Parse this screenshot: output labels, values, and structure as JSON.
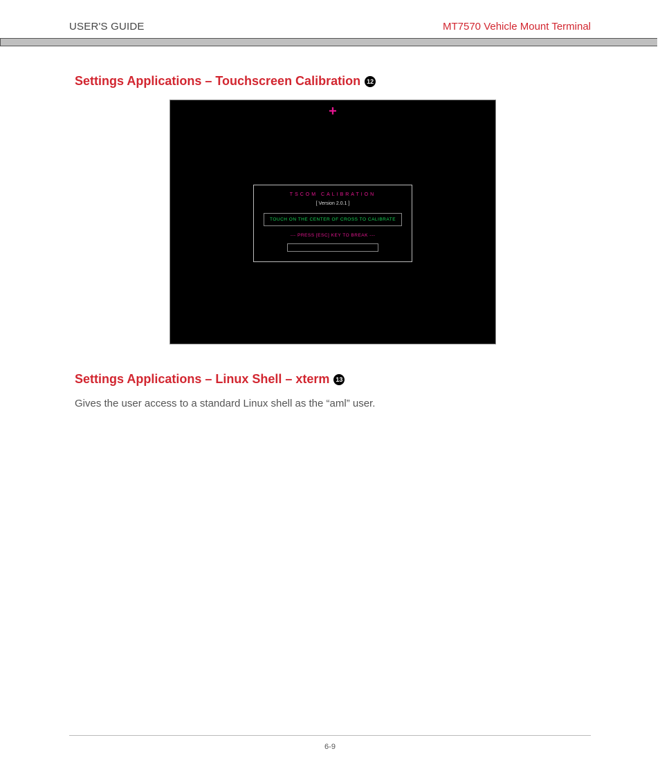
{
  "header": {
    "left": "USER'S GUIDE",
    "right": "MT7570 Vehicle Mount Terminal"
  },
  "section1": {
    "title": "Settings Applications – Touchscreen Calibration",
    "badge": "12",
    "screenshot": {
      "title": "TSCOM CALIBRATION",
      "version": "[ Version 2.0.1 ]",
      "touch_msg": "TOUCH ON THE CENTER OF CROSS TO CALIBRATE",
      "esc_msg": "--- PRESS [ESC] KEY TO BREAK ---"
    }
  },
  "section2": {
    "title": "Settings Applications – Linux Shell – xterm",
    "badge": "13",
    "body": "Gives the user access to a standard Linux shell as the “aml” user."
  },
  "footer": {
    "page": "6-9"
  }
}
